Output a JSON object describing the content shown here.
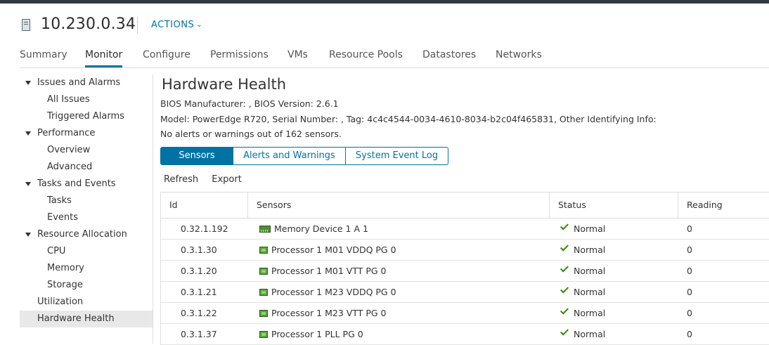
{
  "header": {
    "host_name": "10.230.0.34",
    "actions_label": "ACTIONS"
  },
  "tabs": [
    {
      "label": "Summary"
    },
    {
      "label": "Monitor"
    },
    {
      "label": "Configure"
    },
    {
      "label": "Permissions"
    },
    {
      "label": "VMs"
    },
    {
      "label": "Resource Pools"
    },
    {
      "label": "Datastores"
    },
    {
      "label": "Networks"
    }
  ],
  "active_tab": "Monitor",
  "sidebar": {
    "issues_and_alarms": "Issues and Alarms",
    "all_issues": "All Issues",
    "triggered_alarms": "Triggered Alarms",
    "performance": "Performance",
    "overview": "Overview",
    "advanced": "Advanced",
    "tasks_and_events": "Tasks and Events",
    "tasks": "Tasks",
    "events": "Events",
    "resource_allocation": "Resource Allocation",
    "cpu": "CPU",
    "memory": "Memory",
    "storage": "Storage",
    "utilization": "Utilization",
    "hardware_health": "Hardware Health",
    "selected": "Hardware Health"
  },
  "main": {
    "title": "Hardware Health",
    "bios_line": "BIOS Manufacturer: , BIOS Version: 2.6.1",
    "model_line": "Model: PowerEdge R720, Serial Number: , Tag: 4c4c4544-0034-4610-8034-b2c04f465831, Other Identifying Info:",
    "summary_line": "No alerts or warnings out of 162 sensors.",
    "view_buttons": [
      "Sensors",
      "Alerts and Warnings",
      "System Event Log"
    ],
    "active_view": "Sensors",
    "toolbar": {
      "refresh": "Refresh",
      "export": "Export"
    }
  },
  "grid": {
    "columns": [
      "Id",
      "Sensors",
      "Status",
      "Reading"
    ],
    "rows": [
      {
        "id": "0.32.1.192",
        "sensor": "Memory Device 1 A 1",
        "icon": "memory-icon",
        "status": "Normal",
        "reading": "0"
      },
      {
        "id": "0.3.1.30",
        "sensor": "Processor 1 M01 VDDQ PG 0",
        "icon": "processor-icon",
        "status": "Normal",
        "reading": "0"
      },
      {
        "id": "0.3.1.20",
        "sensor": "Processor 1 M01 VTT PG 0",
        "icon": "processor-icon",
        "status": "Normal",
        "reading": "0"
      },
      {
        "id": "0.3.1.21",
        "sensor": "Processor 1 M23 VDDQ PG 0",
        "icon": "processor-icon",
        "status": "Normal",
        "reading": "0"
      },
      {
        "id": "0.3.1.22",
        "sensor": "Processor 1 M23 VTT PG 0",
        "icon": "processor-icon",
        "status": "Normal",
        "reading": "0"
      },
      {
        "id": "0.3.1.37",
        "sensor": "Processor 1 PLL PG 0",
        "icon": "processor-icon",
        "status": "Normal",
        "reading": "0"
      }
    ]
  },
  "colors": {
    "accent": "#0072a3",
    "status_ok": "#318700",
    "topbar": "#2f3a44",
    "selected_nav": "#e8e8e8"
  }
}
